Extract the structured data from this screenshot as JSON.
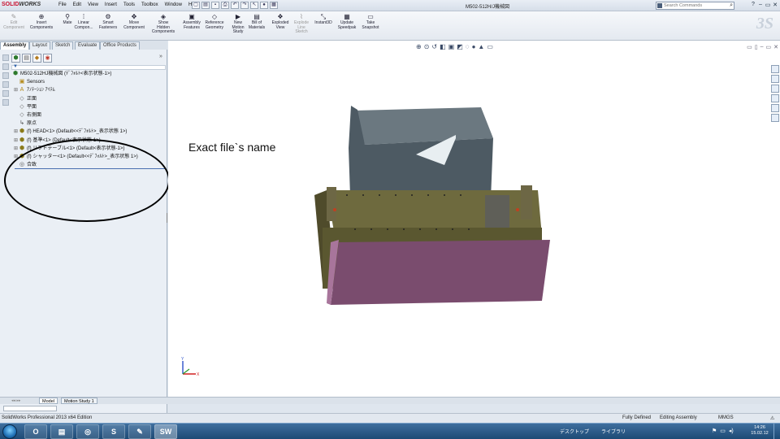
{
  "app": {
    "logo_brand": "SOLID",
    "logo_brand2": "WORKS",
    "doc_title": "M502-512H/J機械図",
    "search_placeholder": "Search Commands"
  },
  "menus": [
    "File",
    "Edit",
    "View",
    "Insert",
    "Tools",
    "Toolbox",
    "Window",
    "Help"
  ],
  "commands": [
    {
      "label": "Edit\nComponent",
      "icon": "edit-component-icon",
      "glyph": "✎",
      "disabled": true
    },
    {
      "label": "Insert\nComponents",
      "icon": "insert-components-icon",
      "glyph": "⊕",
      "disabled": false
    },
    {
      "label": "Mate",
      "icon": "mate-icon",
      "glyph": "⚲",
      "disabled": false
    },
    {
      "label": "Linear\nCompon...",
      "icon": "linear-pattern-icon",
      "glyph": "⁞",
      "disabled": false
    },
    {
      "label": "Smart\nFasteners",
      "icon": "smart-fasteners-icon",
      "glyph": "⚙",
      "disabled": false
    },
    {
      "label": "Move\nComponent",
      "icon": "move-component-icon",
      "glyph": "✥",
      "disabled": false
    },
    {
      "label": "Show\nHidden\nComponents",
      "icon": "show-hidden-icon",
      "glyph": "◈",
      "disabled": false
    },
    {
      "label": "Assembly\nFeatures",
      "icon": "assembly-features-icon",
      "glyph": "▣",
      "disabled": false
    },
    {
      "label": "Reference\nGeometry",
      "icon": "reference-geometry-icon",
      "glyph": "◇",
      "disabled": false
    },
    {
      "label": "New\nMotion\nStudy",
      "icon": "motion-study-icon",
      "glyph": "▶",
      "disabled": false
    },
    {
      "label": "Bill of\nMaterials",
      "icon": "bill-of-materials-icon",
      "glyph": "▤",
      "disabled": false
    },
    {
      "label": "Exploded\nView",
      "icon": "exploded-view-icon",
      "glyph": "❖",
      "disabled": false
    },
    {
      "label": "Explode\nLine\nSketch",
      "icon": "explode-line-icon",
      "glyph": "⌇",
      "disabled": true
    },
    {
      "label": "Instant3D",
      "icon": "instant3d-icon",
      "glyph": "⤡",
      "disabled": false
    },
    {
      "label": "Update\nSpeedpak",
      "icon": "speedpak-icon",
      "glyph": "▦",
      "disabled": false
    },
    {
      "label": "Take\nSnapshot",
      "icon": "snapshot-icon",
      "glyph": "▭",
      "disabled": false
    }
  ],
  "cm_tabs": [
    "Assembly",
    "Layout",
    "Sketch",
    "Evaluate",
    "Office Products"
  ],
  "tree": [
    {
      "label": "M502-512HJ機械図 (ﾃﾞﾌｫﾙﾄ<表示状態-1>)",
      "icon": "assembly-icon",
      "level": 0,
      "expand": ""
    },
    {
      "label": "Sensors",
      "icon": "sensors-icon",
      "level": 1,
      "expand": ""
    },
    {
      "label": "ｱﾉﾃｰｼｮﾝ ｱｲﾃﾑ",
      "icon": "annotations-icon",
      "level": 1,
      "expand": "⊞"
    },
    {
      "label": "正面",
      "icon": "plane-icon",
      "level": 1,
      "expand": ""
    },
    {
      "label": "平面",
      "icon": "plane-icon",
      "level": 1,
      "expand": ""
    },
    {
      "label": "右側面",
      "icon": "plane-icon",
      "level": 1,
      "expand": ""
    },
    {
      "label": "原点",
      "icon": "origin-icon",
      "level": 1,
      "expand": ""
    },
    {
      "label": "(f) HEAD<1> (Default<<ﾃﾞﾌｫﾙﾄ>_表示状態 1>)",
      "icon": "subassembly-icon",
      "level": 1,
      "expand": "⊞"
    },
    {
      "label": "(f) 基準<1> (Default<表示状態-1>)",
      "icon": "subassembly-icon",
      "level": 1,
      "expand": "⊞"
    },
    {
      "label": "(f) リフトテーブル<1> (Default<表示状態-1>)",
      "icon": "subassembly-icon",
      "level": 1,
      "expand": "⊞"
    },
    {
      "label": "(f) シャッター<1> (Default<<ﾃﾞﾌｫﾙﾄ>_表示状態 1>)",
      "icon": "subassembly-icon",
      "level": 1,
      "expand": "⊞"
    },
    {
      "label": "合致",
      "icon": "mates-icon",
      "level": 1,
      "expand": ""
    }
  ],
  "annotation": "Exact file`s name",
  "bottom_tabs": [
    "Model",
    "Motion Study 1"
  ],
  "status": {
    "edition": "SolidWorks Professional 2013 x64 Edition",
    "defined": "Fully Defined",
    "mode": "Editing Assembly",
    "units": "MMGS"
  },
  "taskbar": {
    "desktop": "デスクトップ",
    "library": "ライブラリ",
    "time": "14:26",
    "date": "15.02.12"
  },
  "colors": {
    "head_box": "#4d5a63",
    "base_frame": "#6e6a3e",
    "shutter": "#7a4c6e",
    "accent_red": "#c8102e"
  }
}
